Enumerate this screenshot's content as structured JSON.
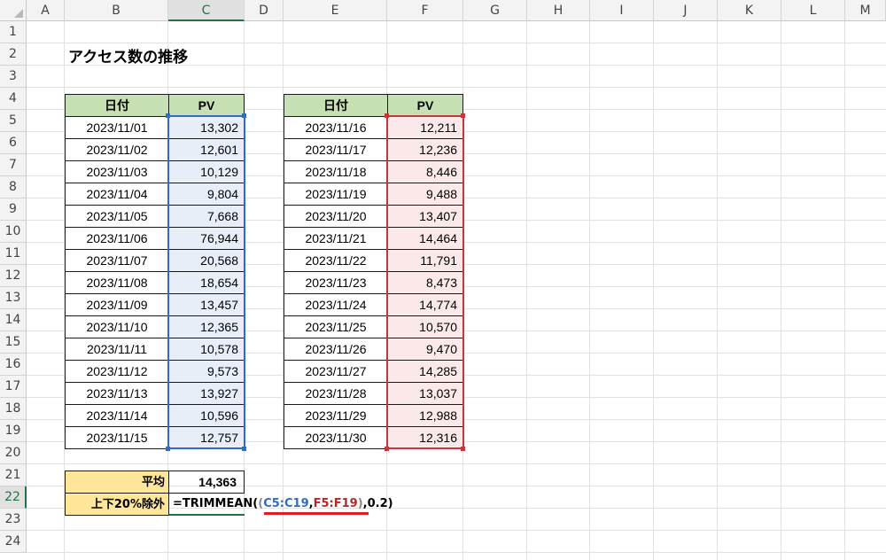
{
  "columns": [
    "A",
    "B",
    "C",
    "D",
    "E",
    "F",
    "G",
    "H",
    "I",
    "J",
    "K",
    "L",
    "M"
  ],
  "rows": [
    "1",
    "2",
    "3",
    "4",
    "5",
    "6",
    "7",
    "8",
    "9",
    "10",
    "11",
    "12",
    "13",
    "14",
    "15",
    "16",
    "17",
    "18",
    "19",
    "20",
    "21",
    "22",
    "23",
    "24"
  ],
  "sheet": {
    "title": "アクセス数の推移",
    "left_table": {
      "header_date": "日付",
      "header_pv": "PV",
      "rows": [
        {
          "date": "2023/11/01",
          "pv": "13,302"
        },
        {
          "date": "2023/11/02",
          "pv": "12,601"
        },
        {
          "date": "2023/11/03",
          "pv": "10,129"
        },
        {
          "date": "2023/11/04",
          "pv": "9,804"
        },
        {
          "date": "2023/11/05",
          "pv": "7,668"
        },
        {
          "date": "2023/11/06",
          "pv": "76,944"
        },
        {
          "date": "2023/11/07",
          "pv": "20,568"
        },
        {
          "date": "2023/11/08",
          "pv": "18,654"
        },
        {
          "date": "2023/11/09",
          "pv": "13,457"
        },
        {
          "date": "2023/11/10",
          "pv": "12,365"
        },
        {
          "date": "2023/11/11",
          "pv": "10,578"
        },
        {
          "date": "2023/11/12",
          "pv": "9,573"
        },
        {
          "date": "2023/11/13",
          "pv": "13,927"
        },
        {
          "date": "2023/11/14",
          "pv": "10,596"
        },
        {
          "date": "2023/11/15",
          "pv": "12,757"
        }
      ]
    },
    "right_table": {
      "header_date": "日付",
      "header_pv": "PV",
      "rows": [
        {
          "date": "2023/11/16",
          "pv": "12,211"
        },
        {
          "date": "2023/11/17",
          "pv": "12,236"
        },
        {
          "date": "2023/11/18",
          "pv": "8,446"
        },
        {
          "date": "2023/11/19",
          "pv": "9,488"
        },
        {
          "date": "2023/11/20",
          "pv": "13,407"
        },
        {
          "date": "2023/11/21",
          "pv": "14,464"
        },
        {
          "date": "2023/11/22",
          "pv": "11,791"
        },
        {
          "date": "2023/11/23",
          "pv": "8,473"
        },
        {
          "date": "2023/11/24",
          "pv": "14,774"
        },
        {
          "date": "2023/11/25",
          "pv": "10,570"
        },
        {
          "date": "2023/11/26",
          "pv": "9,470"
        },
        {
          "date": "2023/11/27",
          "pv": "14,285"
        },
        {
          "date": "2023/11/28",
          "pv": "13,037"
        },
        {
          "date": "2023/11/29",
          "pv": "12,988"
        },
        {
          "date": "2023/11/30",
          "pv": "12,316"
        }
      ]
    },
    "average_label": "平均",
    "average_value": "14,363",
    "trimmed_label": "上下20%除外",
    "formula": {
      "prefix": "=TRIMMEAN(",
      "open_paren": "(",
      "range1": "C5:C19",
      "comma": ",",
      "range2": "F5:F19",
      "close_paren": ")",
      "suffix": ",0.2)"
    }
  },
  "colors": {
    "header_green": "#c6e0b4",
    "yellow": "#ffe699",
    "range_blue": "#2f6cc2",
    "range_red": "#b02a2a",
    "excel_green": "#217346"
  }
}
